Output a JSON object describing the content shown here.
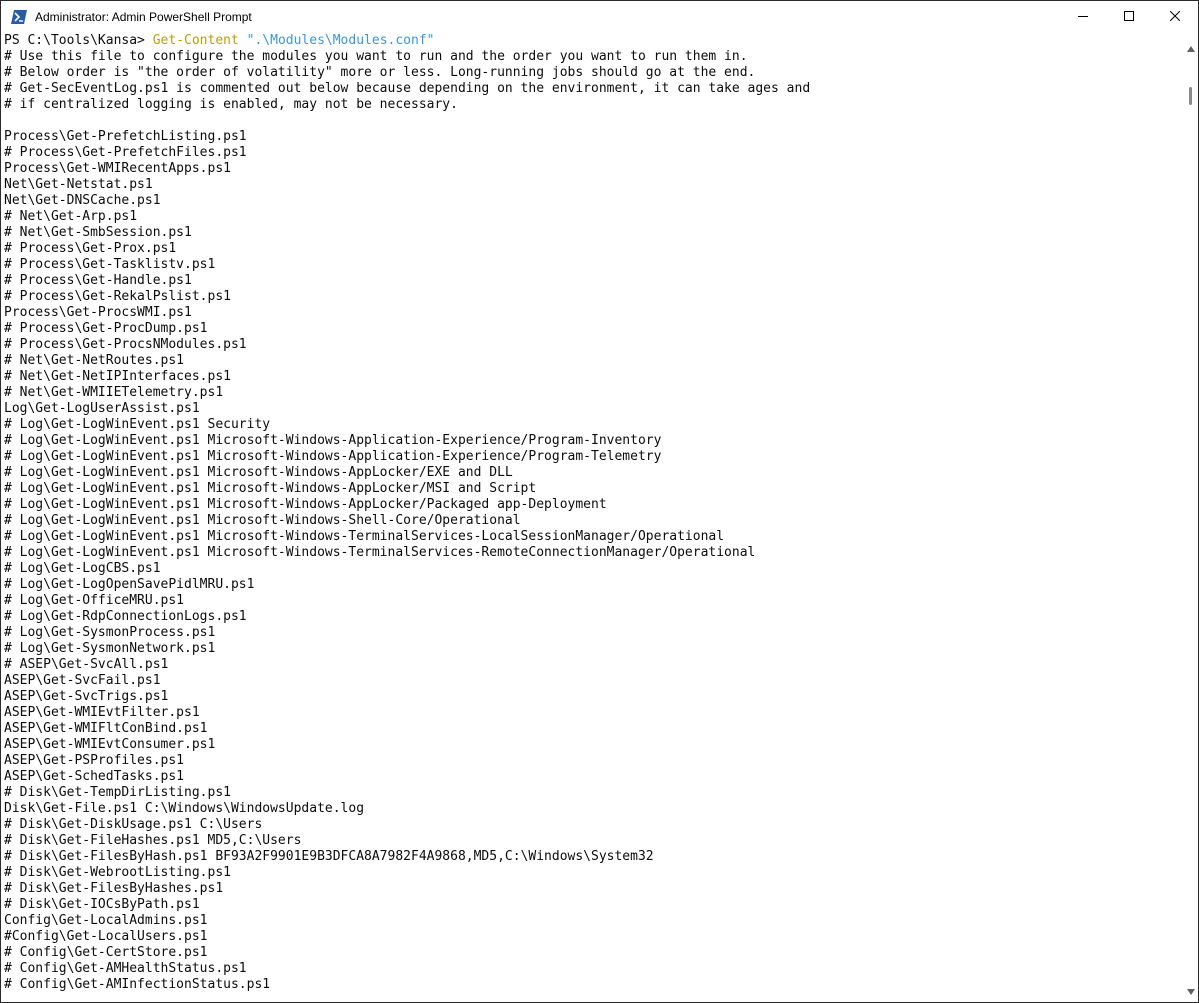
{
  "window": {
    "title": "Administrator: Admin PowerShell Prompt",
    "colors": {
      "background": "#ffffff",
      "text": "#0c0c0c",
      "command": "#c19c00",
      "string": "#3a96dd",
      "icon": "#2a5ba8"
    },
    "controls": {
      "minimize_icon": "minimize-icon",
      "maximize_icon": "maximize-icon",
      "close_icon": "close-icon"
    }
  },
  "console": {
    "prompt": "PS C:\\Tools\\Kansa> ",
    "command": "Get-Content",
    "argument": "\".\\Modules\\Modules.conf\"",
    "lines": [
      "# Use this file to configure the modules you want to run and the order you want to run them in.",
      "# Below order is \"the order of volatility\" more or less. Long-running jobs should go at the end.",
      "# Get-SecEventLog.ps1 is commented out below because depending on the environment, it can take ages and",
      "# if centralized logging is enabled, may not be necessary.",
      "",
      "Process\\Get-PrefetchListing.ps1",
      "# Process\\Get-PrefetchFiles.ps1",
      "Process\\Get-WMIRecentApps.ps1",
      "Net\\Get-Netstat.ps1",
      "Net\\Get-DNSCache.ps1",
      "# Net\\Get-Arp.ps1",
      "# Net\\Get-SmbSession.ps1",
      "# Process\\Get-Prox.ps1",
      "# Process\\Get-Tasklistv.ps1",
      "# Process\\Get-Handle.ps1",
      "# Process\\Get-RekalPslist.ps1",
      "Process\\Get-ProcsWMI.ps1",
      "# Process\\Get-ProcDump.ps1",
      "# Process\\Get-ProcsNModules.ps1",
      "# Net\\Get-NetRoutes.ps1",
      "# Net\\Get-NetIPInterfaces.ps1",
      "# Net\\Get-WMIIETelemetry.ps1",
      "Log\\Get-LogUserAssist.ps1",
      "# Log\\Get-LogWinEvent.ps1 Security",
      "# Log\\Get-LogWinEvent.ps1 Microsoft-Windows-Application-Experience/Program-Inventory",
      "# Log\\Get-LogWinEvent.ps1 Microsoft-Windows-Application-Experience/Program-Telemetry",
      "# Log\\Get-LogWinEvent.ps1 Microsoft-Windows-AppLocker/EXE and DLL",
      "# Log\\Get-LogWinEvent.ps1 Microsoft-Windows-AppLocker/MSI and Script",
      "# Log\\Get-LogWinEvent.ps1 Microsoft-Windows-AppLocker/Packaged app-Deployment",
      "# Log\\Get-LogWinEvent.ps1 Microsoft-Windows-Shell-Core/Operational",
      "# Log\\Get-LogWinEvent.ps1 Microsoft-Windows-TerminalServices-LocalSessionManager/Operational",
      "# Log\\Get-LogWinEvent.ps1 Microsoft-Windows-TerminalServices-RemoteConnectionManager/Operational",
      "# Log\\Get-LogCBS.ps1",
      "# Log\\Get-LogOpenSavePidlMRU.ps1",
      "# Log\\Get-OfficeMRU.ps1",
      "# Log\\Get-RdpConnectionLogs.ps1",
      "# Log\\Get-SysmonProcess.ps1",
      "# Log\\Get-SysmonNetwork.ps1",
      "# ASEP\\Get-SvcAll.ps1",
      "ASEP\\Get-SvcFail.ps1",
      "ASEP\\Get-SvcTrigs.ps1",
      "ASEP\\Get-WMIEvtFilter.ps1",
      "ASEP\\Get-WMIFltConBind.ps1",
      "ASEP\\Get-WMIEvtConsumer.ps1",
      "ASEP\\Get-PSProfiles.ps1",
      "ASEP\\Get-SchedTasks.ps1",
      "# Disk\\Get-TempDirListing.ps1",
      "Disk\\Get-File.ps1 C:\\Windows\\WindowsUpdate.log",
      "# Disk\\Get-DiskUsage.ps1 C:\\Users",
      "# Disk\\Get-FileHashes.ps1 MD5,C:\\Users",
      "# Disk\\Get-FilesByHash.ps1 BF93A2F9901E9B3DFCA8A7982F4A9868,MD5,C:\\Windows\\System32",
      "# Disk\\Get-WebrootListing.ps1",
      "# Disk\\Get-FilesByHashes.ps1",
      "# Disk\\Get-IOCsByPath.ps1",
      "Config\\Get-LocalAdmins.ps1",
      "#Config\\Get-LocalUsers.ps1",
      "# Config\\Get-CertStore.ps1",
      "# Config\\Get-AMHealthStatus.ps1",
      "# Config\\Get-AMInfectionStatus.ps1"
    ]
  }
}
